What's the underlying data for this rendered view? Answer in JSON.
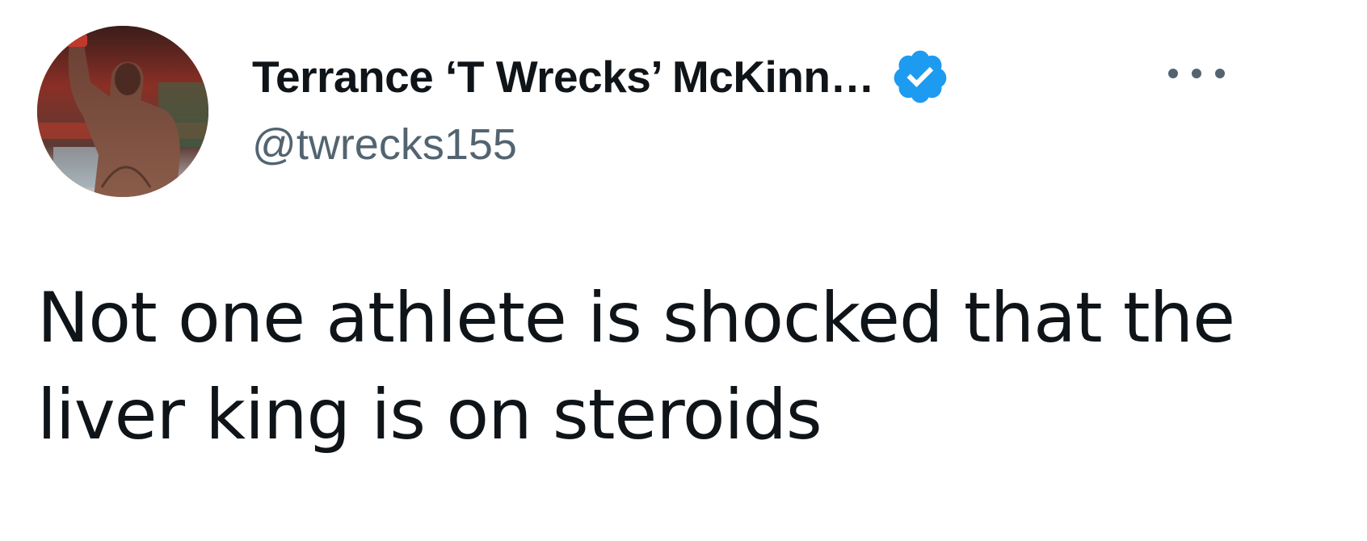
{
  "tweet": {
    "author": {
      "display_name": "Terrance ‘T Wrecks’ McKinn…",
      "handle": "@twrecks155",
      "verified_icon": "verified-badge-icon",
      "avatar_icon": "profile-photo"
    },
    "more_icon": "more-options-icon",
    "text": "Not one athlete is shocked that the liver king is on steroids"
  },
  "colors": {
    "background": "#ffffff",
    "text_primary": "#0f1419",
    "text_secondary": "#536471",
    "verified_blue": "#1d9bf0"
  }
}
